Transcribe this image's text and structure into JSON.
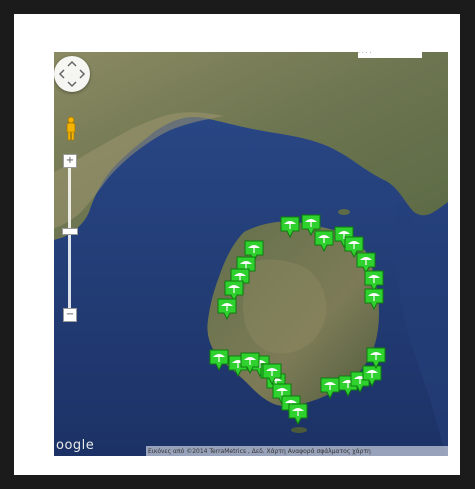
{
  "map": {
    "provider_logo": "oogle",
    "attribution": "Εικόνες από ©2014 TerraMetrics , Δεδ. Χάρτη   Αναφορά σφάλματος χάρτη",
    "top_label": "· · · ·",
    "zoom_in_label": "+",
    "zoom_out_label": "−",
    "controls": {
      "pan": "pan-control",
      "street_view": "pegman-icon",
      "zoom_level": 0.43
    },
    "marker_icon": "beach-umbrella-pin-icon",
    "marker_color": "#2fd12f",
    "water_color": "#223d78",
    "land_color": "#6f7b55",
    "markers": [
      {
        "id": "m1"
      },
      {
        "id": "m2"
      },
      {
        "id": "m3"
      },
      {
        "id": "m4"
      },
      {
        "id": "m5"
      },
      {
        "id": "m6"
      },
      {
        "id": "m7"
      },
      {
        "id": "m8"
      },
      {
        "id": "m9"
      },
      {
        "id": "m10"
      },
      {
        "id": "m11"
      },
      {
        "id": "m12"
      },
      {
        "id": "m13"
      },
      {
        "id": "m14"
      },
      {
        "id": "m15"
      },
      {
        "id": "m16"
      },
      {
        "id": "m17"
      },
      {
        "id": "m18"
      },
      {
        "id": "m19"
      },
      {
        "id": "m20"
      },
      {
        "id": "m21"
      },
      {
        "id": "m22"
      },
      {
        "id": "m23"
      },
      {
        "id": "m24"
      },
      {
        "id": "m25"
      },
      {
        "id": "m26"
      },
      {
        "id": "m27"
      },
      {
        "id": "m28"
      }
    ]
  }
}
